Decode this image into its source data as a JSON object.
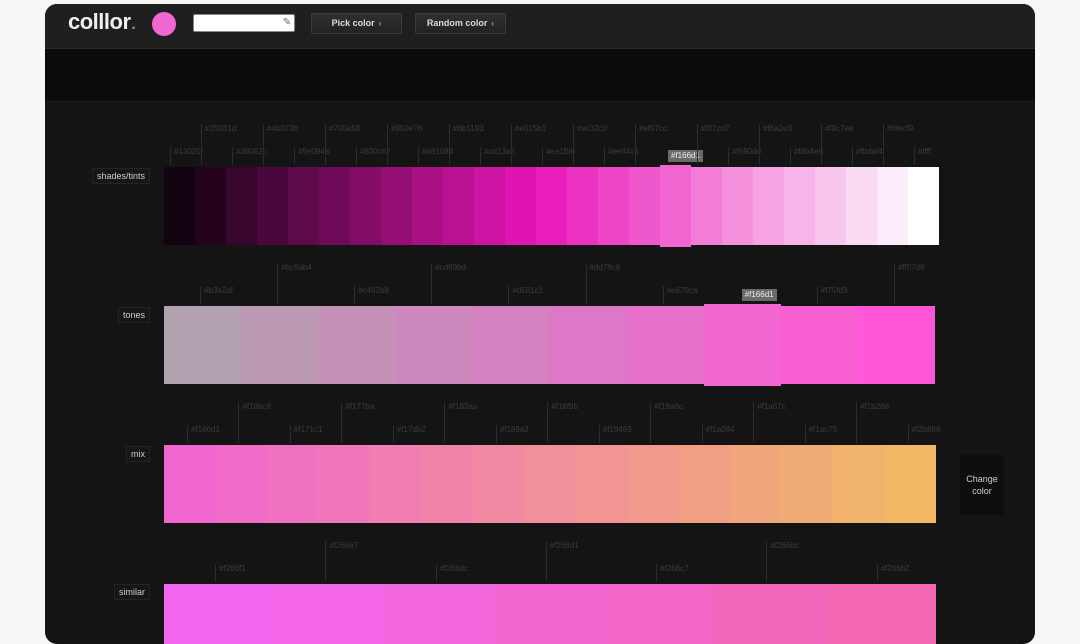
{
  "app": {
    "logo_text": "colllor",
    "logo_dot": ".",
    "current_color": "#f166d1",
    "hex_input_value": "",
    "pick_label": "Pick color",
    "random_label": "Random color",
    "caret": "‹",
    "change_color_label": "Change color"
  },
  "rows": [
    {
      "label": "shades/tints",
      "colors": [
        "#13020f",
        "#25031d",
        "#38052c",
        "#4b073b",
        "#5e094a",
        "#700a58",
        "#830c67",
        "#950e76",
        "#a81084",
        "#bb1193",
        "#cd13a2",
        "#e015b1",
        "#ea1fbb",
        "#ec32c0",
        "#ee44c6",
        "#ef57cc",
        "#f166d1",
        "#f37cd7",
        "#f590dd",
        "#f6a2e3",
        "#f8b4e8",
        "#f9c7ee",
        "#fbdaf4",
        "#fdecf9",
        "#ffffff"
      ],
      "labels": [
        "#13020f",
        "#25031d",
        "#38052c",
        "#4b073b",
        "#5e094a",
        "#700a58",
        "#830c67",
        "#950e76",
        "#a81084",
        "#bb1193",
        "#cd13a2",
        "#e015b1",
        "#ea1fbb",
        "#ec32c0",
        "#ee44c6",
        "#ef57cc",
        "#f166d1",
        "#f37cd7",
        "#f590dd",
        "#f6a2e3",
        "#f8b4e8",
        "#f9c7ee",
        "#fbdaf4",
        "#fdecf9",
        "#ffff"
      ],
      "selected_index": 16
    },
    {
      "label": "tones",
      "colors": [
        "#b3a2af",
        "#bc9ab4",
        "#c492b8",
        "#cd89bd",
        "#d581c1",
        "#dd78c6",
        "#e670ca",
        "#f166d1",
        "#f75fd3",
        "#ff57d8"
      ],
      "labels": [
        "#b3a2af",
        "#bc9ab4",
        "#c492b8",
        "#cd89bd",
        "#d581c1",
        "#dd78c6",
        "#e670ca",
        "#f166d1",
        "#f75fd3",
        "#ff57d8"
      ],
      "selected_index": 7
    },
    {
      "label": "mix",
      "colors": [
        "#f166d1",
        "#f16bc9",
        "#f171c1",
        "#f177ba",
        "#f17db2",
        "#f183aa",
        "#f189a3",
        "#f18f9b",
        "#f19493",
        "#f19a8c",
        "#f1a084",
        "#f1a67c",
        "#f1ac75",
        "#f1b26d",
        "#f2b866"
      ],
      "labels": [
        "#f166d1",
        "#f16bc9",
        "#f171c1",
        "#f177ba",
        "#f17db2",
        "#f183aa",
        "#f189a3",
        "#f18f9b",
        "#f19493",
        "#f19a8c",
        "#f1a084",
        "#f1a67c",
        "#f1ac75",
        "#f1b26d",
        "#f2b866"
      ],
      "selected_index": -1
    },
    {
      "label": "similar",
      "colors": [
        "#f266f1",
        "#f266e7",
        "#f266dc",
        "#f266d1",
        "#f266c7",
        "#f266bc",
        "#f266b2"
      ],
      "labels": [
        "#f266f1",
        "#f266e7",
        "#f266dc",
        "#f266d1",
        "#f266c7",
        "#f266bc",
        "#f266b2"
      ],
      "selected_index": -1
    }
  ]
}
